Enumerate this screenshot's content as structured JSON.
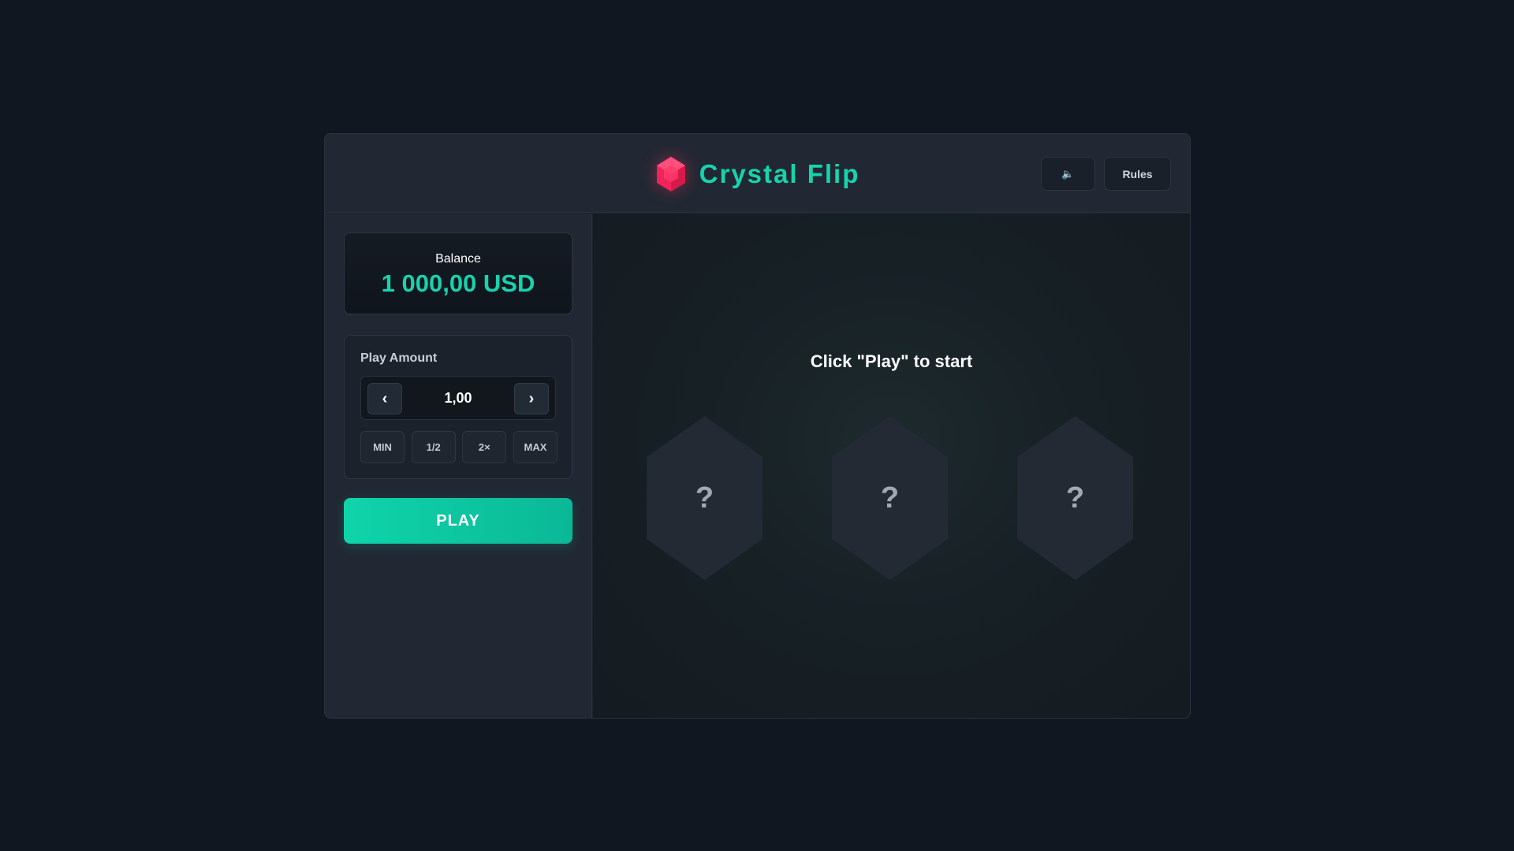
{
  "header": {
    "title": "Crystal Flip",
    "logo_icon": "crystal-gem-icon",
    "sound_icon": "speaker-icon",
    "sound_symbol": "🔈",
    "rules_label": "Rules"
  },
  "sidebar": {
    "balance": {
      "label": "Balance",
      "value": "1 000,00 USD"
    },
    "play_amount": {
      "label": "Play Amount",
      "decrease_symbol": "‹",
      "value": "1,00",
      "increase_symbol": "›",
      "quick_buttons": [
        "MIN",
        "1/2",
        "2×",
        "MAX"
      ]
    },
    "play_label": "PLAY"
  },
  "board": {
    "prompt": "Click \"Play\" to start",
    "crystals": [
      {
        "mark": "?"
      },
      {
        "mark": "?"
      },
      {
        "mark": "?"
      }
    ]
  },
  "colors": {
    "accent": "#17d3ae",
    "logo_gem": "#ff2e63",
    "background": "#111720",
    "panel": "#212833"
  }
}
